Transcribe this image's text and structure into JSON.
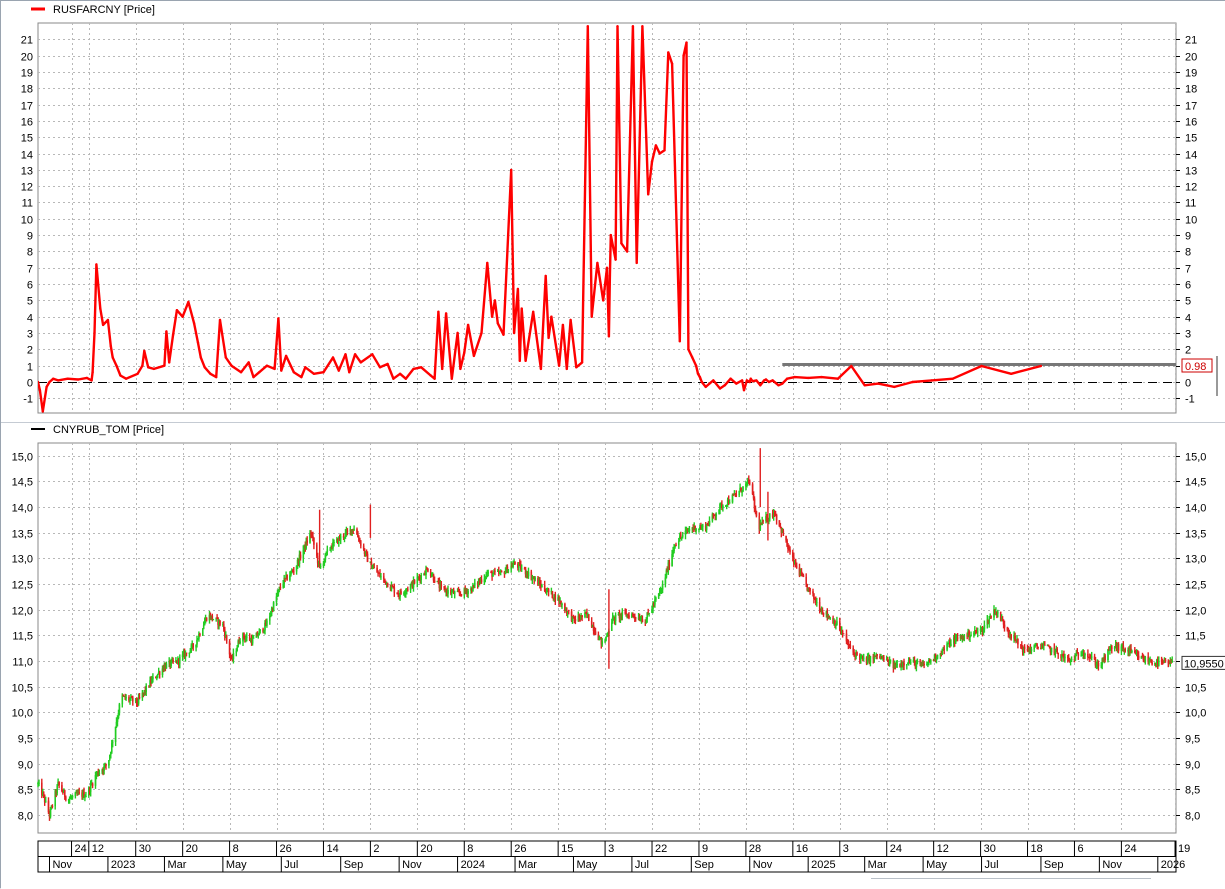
{
  "colors": {
    "background": "#ffffff",
    "grid": "#b8b8b8",
    "top_line": "#ff0000",
    "candle_up": "#22cc22",
    "candle_down": "#e02020",
    "reference_line": "#777777",
    "price_tag_border": "#cc0000",
    "price_tag_text": "#cc0000"
  },
  "chart_data": [
    {
      "type": "line",
      "legend": "RUSFARCNY [Price]",
      "legend_placement": "top-left",
      "grid": true,
      "ylim": [
        -1.9,
        22.0
      ],
      "y_ticks": [
        "-1",
        "0",
        "1",
        "2",
        "3",
        "4",
        "5",
        "6",
        "7",
        "8",
        "9",
        "10",
        "11",
        "12",
        "13",
        "14",
        "15",
        "16",
        "17",
        "18",
        "19",
        "20",
        "21"
      ],
      "last_value_label": "0.98",
      "reference_level": 1.1,
      "zero_line": 0,
      "x_range": [
        "2022-10-20",
        "2026-01-20"
      ],
      "x": [
        "2022-10-20",
        "2022-10-22",
        "2022-10-25",
        "2022-10-29",
        "2022-11-01",
        "2022-11-05",
        "2022-11-10",
        "2022-11-20",
        "2022-12-01",
        "2022-12-10",
        "2022-12-15",
        "2022-12-16",
        "2022-12-18",
        "2022-12-20",
        "2022-12-24",
        "2022-12-27",
        "2023-01-01",
        "2023-01-04",
        "2023-01-06",
        "2023-01-10",
        "2023-01-14",
        "2023-01-20",
        "2023-02-01",
        "2023-02-06",
        "2023-02-08",
        "2023-02-12",
        "2023-02-18",
        "2023-03-01",
        "2023-03-03",
        "2023-03-06",
        "2023-03-10",
        "2023-03-14",
        "2023-03-20",
        "2023-03-26",
        "2023-04-01",
        "2023-04-05",
        "2023-04-08",
        "2023-04-12",
        "2023-04-18",
        "2023-04-24",
        "2023-04-28",
        "2023-05-04",
        "2023-05-10",
        "2023-05-20",
        "2023-05-28",
        "2023-06-02",
        "2023-06-08",
        "2023-06-16",
        "2023-06-24",
        "2023-06-28",
        "2023-07-01",
        "2023-07-06",
        "2023-07-14",
        "2023-07-22",
        "2023-07-26",
        "2023-08-04",
        "2023-08-14",
        "2023-08-24",
        "2023-08-30",
        "2023-09-06",
        "2023-09-10",
        "2023-09-16",
        "2023-09-22",
        "2023-10-04",
        "2023-10-12",
        "2023-10-20",
        "2023-10-26",
        "2023-11-02",
        "2023-11-08",
        "2023-11-16",
        "2023-11-24",
        "2023-12-04",
        "2023-12-08",
        "2023-12-12",
        "2023-12-16",
        "2023-12-20",
        "2023-12-26",
        "2024-01-01",
        "2024-01-04",
        "2024-01-08",
        "2024-01-12",
        "2024-01-18",
        "2024-01-26",
        "2024-02-01",
        "2024-02-06",
        "2024-02-09",
        "2024-02-12",
        "2024-02-18",
        "2024-02-26",
        "2024-02-29",
        "2024-03-04",
        "2024-03-06",
        "2024-03-08",
        "2024-03-12",
        "2024-03-20",
        "2024-03-28",
        "2024-04-02",
        "2024-04-05",
        "2024-04-08",
        "2024-04-16",
        "2024-04-20",
        "2024-04-24",
        "2024-04-28",
        "2024-05-04",
        "2024-05-10",
        "2024-05-16",
        "2024-05-20",
        "2024-05-26",
        "2024-06-01",
        "2024-06-05",
        "2024-06-07",
        "2024-06-08",
        "2024-06-09",
        "2024-06-14",
        "2024-06-16",
        "2024-06-20",
        "2024-06-26",
        "2024-07-02",
        "2024-07-06",
        "2024-07-12",
        "2024-07-18",
        "2024-07-22",
        "2024-07-26",
        "2024-07-30",
        "2024-08-04",
        "2024-08-08",
        "2024-08-12",
        "2024-08-20",
        "2024-08-24",
        "2024-08-27",
        "2024-08-29",
        "2024-09-02",
        "2024-09-06",
        "2024-09-08",
        "2024-09-10",
        "2024-09-12",
        "2024-09-16",
        "2024-09-20",
        "2024-09-24",
        "2024-10-01",
        "2024-10-06",
        "2024-10-12",
        "2024-10-18",
        "2024-10-24",
        "2024-10-26",
        "2024-10-29",
        "2024-11-01",
        "2024-11-02",
        "2024-11-04",
        "2024-11-08",
        "2024-11-12",
        "2024-11-16",
        "2024-11-18",
        "2024-11-21",
        "2024-11-25",
        "2024-12-01",
        "2024-12-05",
        "2024-12-10",
        "2024-12-18",
        "2025-01-01",
        "2025-01-15",
        "2025-02-01",
        "2025-02-15",
        "2025-03-01",
        "2025-03-15",
        "2025-04-01",
        "2025-04-20",
        "2025-05-10",
        "2025-06-01",
        "2025-07-01",
        "2025-08-01",
        "2025-09-01",
        "2025-10-01",
        "2025-11-01",
        "2025-12-01",
        "2026-01-01",
        "2026-01-10",
        "2026-01-16"
      ],
      "values": [
        0.0,
        -0.5,
        -1.8,
        -0.3,
        0.0,
        0.2,
        0.1,
        0.2,
        0.15,
        0.25,
        0.1,
        0.6,
        3.0,
        7.2,
        4.5,
        3.5,
        3.8,
        2.2,
        1.5,
        1.0,
        0.4,
        0.2,
        0.5,
        1.0,
        1.9,
        0.9,
        0.8,
        1.0,
        3.1,
        1.2,
        2.9,
        4.4,
        4.0,
        4.9,
        3.6,
        2.4,
        1.5,
        0.9,
        0.5,
        0.3,
        3.8,
        1.5,
        1.0,
        0.6,
        1.2,
        0.3,
        0.6,
        1.0,
        0.8,
        3.9,
        0.7,
        1.6,
        0.6,
        0.3,
        0.9,
        0.5,
        0.6,
        1.5,
        0.7,
        1.7,
        0.6,
        1.7,
        1.2,
        1.7,
        0.9,
        1.1,
        0.2,
        0.5,
        0.2,
        0.8,
        0.9,
        0.4,
        0.2,
        4.3,
        0.8,
        4.2,
        0.2,
        3.0,
        0.8,
        1.8,
        3.5,
        1.6,
        3.0,
        7.3,
        4.0,
        5.0,
        3.6,
        2.9,
        13.0,
        3.0,
        5.7,
        1.3,
        4.5,
        1.3,
        4.3,
        0.8,
        6.5,
        2.7,
        4.0,
        1.0,
        3.5,
        0.8,
        3.8,
        0.9,
        1.2,
        21.8,
        4.0,
        7.3,
        5.0,
        7.0,
        2.8,
        6.5,
        9.0,
        7.5,
        21.8,
        8.5,
        8.0,
        21.8,
        7.3,
        21.8,
        11.5,
        13.5,
        14.5,
        14.0,
        14.2,
        20.2,
        19.5,
        2.5,
        20.0,
        20.8,
        2.0,
        1.5,
        1.0,
        0.5,
        0.3,
        0.0,
        -0.3,
        -0.1,
        0.1,
        -0.4,
        -0.2,
        0.2,
        -0.1,
        0.1,
        -0.5,
        0.1,
        0.0,
        0.2,
        0.05,
        0.1,
        -0.2,
        0.1,
        0.15,
        0.0,
        0.1,
        -0.2,
        -0.1,
        0.2,
        0.3,
        0.25,
        0.3,
        0.2,
        0.98,
        -0.2,
        -0.1,
        -0.3,
        0.0,
        0.1,
        0.2,
        0.98,
        0.5,
        0.98
      ]
    },
    {
      "type": "candlestick",
      "legend": "CNYRUB_TOM [Price]",
      "legend_placement": "top-left",
      "grid": true,
      "ylim": [
        7.65,
        15.25
      ],
      "y_ticks": [
        "8,0",
        "8,5",
        "9,0",
        "9,5",
        "10,0",
        "10,5",
        "11,0",
        "11,5",
        "12,0",
        "12,5",
        "13,0",
        "13,5",
        "14,0",
        "14,5",
        "15,0"
      ],
      "last_value_label": "10,9550",
      "x_range": [
        "2022-10-20",
        "2026-01-20"
      ],
      "anchor_dates": [
        "2022-10-20",
        "2022-10-25",
        "2022-11-01",
        "2022-11-10",
        "2022-11-20",
        "2022-12-01",
        "2022-12-10",
        "2022-12-20",
        "2023-01-01",
        "2023-01-15",
        "2023-02-01",
        "2023-02-15",
        "2023-03-01",
        "2023-03-15",
        "2023-04-01",
        "2023-04-15",
        "2023-05-01",
        "2023-05-10",
        "2023-05-20",
        "2023-06-01",
        "2023-06-15",
        "2023-07-01",
        "2023-07-15",
        "2023-08-01",
        "2023-08-10",
        "2023-08-20",
        "2023-09-01",
        "2023-09-15",
        "2023-10-01",
        "2023-10-15",
        "2023-11-01",
        "2023-11-15",
        "2023-12-01",
        "2023-12-15",
        "2024-01-01",
        "2024-01-15",
        "2024-02-01",
        "2024-02-15",
        "2024-03-01",
        "2024-03-15",
        "2024-04-01",
        "2024-04-15",
        "2024-05-01",
        "2024-05-15",
        "2024-06-01",
        "2024-06-10",
        "2024-06-20",
        "2024-07-01",
        "2024-07-15",
        "2024-08-01",
        "2024-08-15",
        "2024-09-01",
        "2024-09-15",
        "2024-10-01",
        "2024-10-15",
        "2024-11-01",
        "2024-11-10",
        "2024-11-20",
        "2024-11-27",
        "2024-12-05",
        "2024-12-15",
        "2025-01-01",
        "2025-01-15",
        "2025-02-01",
        "2025-02-15",
        "2025-03-01",
        "2025-03-15",
        "2025-04-01",
        "2025-04-15",
        "2025-05-01",
        "2025-05-15",
        "2025-06-01",
        "2025-06-15",
        "2025-07-01",
        "2025-07-15",
        "2025-08-01",
        "2025-08-15",
        "2025-09-01",
        "2025-09-15",
        "2025-10-01",
        "2025-10-15",
        "2025-11-01",
        "2025-11-15",
        "2025-12-01",
        "2025-12-15",
        "2026-01-01",
        "2026-01-16"
      ],
      "anchor_values": [
        8.6,
        8.4,
        8.0,
        8.6,
        8.3,
        8.4,
        8.4,
        8.8,
        9.0,
        10.3,
        10.2,
        10.6,
        10.9,
        11.0,
        11.3,
        11.9,
        11.7,
        11.0,
        11.5,
        11.4,
        11.7,
        12.5,
        12.8,
        13.5,
        12.8,
        13.2,
        13.4,
        13.6,
        12.9,
        12.6,
        12.3,
        12.5,
        12.8,
        12.4,
        12.3,
        12.4,
        12.7,
        12.7,
        12.9,
        12.7,
        12.4,
        12.2,
        11.8,
        11.9,
        11.3,
        11.8,
        11.9,
        11.9,
        11.8,
        12.4,
        13.3,
        13.6,
        13.6,
        14.0,
        14.2,
        14.5,
        13.6,
        13.8,
        13.9,
        13.5,
        13.0,
        12.4,
        12.0,
        11.7,
        11.2,
        11.0,
        11.1,
        10.9,
        11.0,
        10.9,
        11.1,
        11.4,
        11.5,
        11.6,
        12.0,
        11.5,
        11.2,
        11.3,
        11.2,
        11.0,
        11.2,
        10.9,
        11.3,
        11.2,
        11.05,
        10.96,
        10.955
      ]
    }
  ],
  "x_axis": {
    "day_labels": [
      {
        "date": "2022-11-24",
        "text": "24"
      },
      {
        "date": "2022-12-12",
        "text": "12"
      },
      {
        "date": "2023-01-30",
        "text": "30"
      },
      {
        "date": "2023-03-20",
        "text": "20"
      },
      {
        "date": "2023-05-08",
        "text": "8"
      },
      {
        "date": "2023-06-26",
        "text": "26"
      },
      {
        "date": "2023-08-14",
        "text": "14"
      },
      {
        "date": "2023-10-02",
        "text": "2"
      },
      {
        "date": "2023-11-20",
        "text": "20"
      },
      {
        "date": "2024-01-08",
        "text": "8"
      },
      {
        "date": "2024-02-26",
        "text": "26"
      },
      {
        "date": "2024-04-15",
        "text": "15"
      },
      {
        "date": "2024-06-03",
        "text": "3"
      },
      {
        "date": "2024-07-22",
        "text": "22"
      },
      {
        "date": "2024-09-09",
        "text": "9"
      },
      {
        "date": "2024-10-28",
        "text": "28"
      },
      {
        "date": "2024-12-16",
        "text": "16"
      },
      {
        "date": "2025-02-03",
        "text": "3"
      },
      {
        "date": "2025-03-24",
        "text": "24"
      },
      {
        "date": "2025-05-12",
        "text": "12"
      },
      {
        "date": "2025-06-30",
        "text": "30"
      },
      {
        "date": "2025-08-18",
        "text": "18"
      },
      {
        "date": "2025-10-06",
        "text": "6"
      },
      {
        "date": "2025-11-24",
        "text": "24"
      },
      {
        "date": "2026-01-19",
        "text": "19"
      }
    ],
    "month_labels": [
      {
        "date": "2022-11-01",
        "text": "Nov"
      },
      {
        "date": "2023-01-01",
        "text": "2023"
      },
      {
        "date": "2023-03-01",
        "text": "Mar"
      },
      {
        "date": "2023-05-01",
        "text": "May"
      },
      {
        "date": "2023-07-01",
        "text": "Jul"
      },
      {
        "date": "2023-09-01",
        "text": "Sep"
      },
      {
        "date": "2023-11-01",
        "text": "Nov"
      },
      {
        "date": "2024-01-01",
        "text": "2024"
      },
      {
        "date": "2024-03-01",
        "text": "Mar"
      },
      {
        "date": "2024-05-01",
        "text": "May"
      },
      {
        "date": "2024-07-01",
        "text": "Jul"
      },
      {
        "date": "2024-09-01",
        "text": "Sep"
      },
      {
        "date": "2024-11-01",
        "text": "Nov"
      },
      {
        "date": "2025-01-01",
        "text": "2025"
      },
      {
        "date": "2025-03-01",
        "text": "Mar"
      },
      {
        "date": "2025-05-01",
        "text": "May"
      },
      {
        "date": "2025-07-01",
        "text": "Jul"
      },
      {
        "date": "2025-09-01",
        "text": "Sep"
      },
      {
        "date": "2025-11-01",
        "text": "Nov"
      },
      {
        "date": "2026-01-01",
        "text": "2026"
      }
    ]
  }
}
